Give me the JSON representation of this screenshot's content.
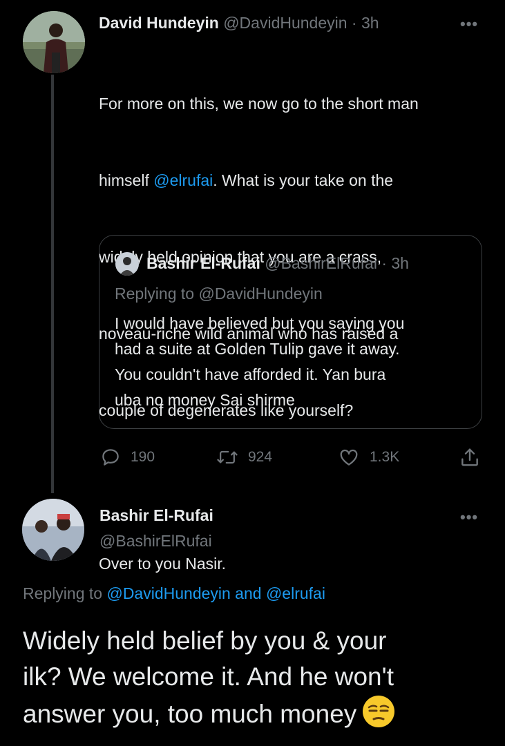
{
  "tweet1": {
    "author_name": "David Hundeyin",
    "handle": "@DavidHundeyin",
    "time": "· 3h",
    "more_icon": "more-horizontal-icon",
    "lines": [
      "For more on this, we now go to the short man",
      "himself ",
      "@elrufai",
      ". What is your take on the",
      "widely held opinion that you are a crass,",
      "noveau-riche wild animal who has raised a",
      "couple of degenerates like yourself?",
      "Over to you Nasir."
    ],
    "quote": {
      "author_name": "Bashir El-Rufai",
      "handle": "@BashirElRufai",
      "time": "· 3h",
      "replying_to_label": "Replying to ",
      "replying_to_handle": "@DavidHundeyin",
      "lines": [
        "I would have believed but you saying you",
        "had a suite at Golden Tulip gave it away.",
        "You couldn't have afforded it. Yan bura",
        "uba no money Sai shirme"
      ]
    },
    "actions": {
      "replies": "190",
      "retweets": "924",
      "likes": "1.3K"
    }
  },
  "tweet2": {
    "author_name": "Bashir El-Rufai",
    "handle": "@BashirElRufai",
    "replying_to_label": "Replying to ",
    "replying_to_handle1": "@DavidHundeyin",
    "replying_to_and": " and ",
    "replying_to_handle2": "@elrufai",
    "lines": [
      "Widely held belief by you & your",
      "ilk? We welcome it. And he won't",
      "answer you, too much money"
    ],
    "emoji": "unamused-face-emoji"
  },
  "colors": {
    "background": "#000000",
    "text": "#e7e9ea",
    "muted": "#71767b",
    "link": "#1d9bf0",
    "border": "#3e4144"
  }
}
